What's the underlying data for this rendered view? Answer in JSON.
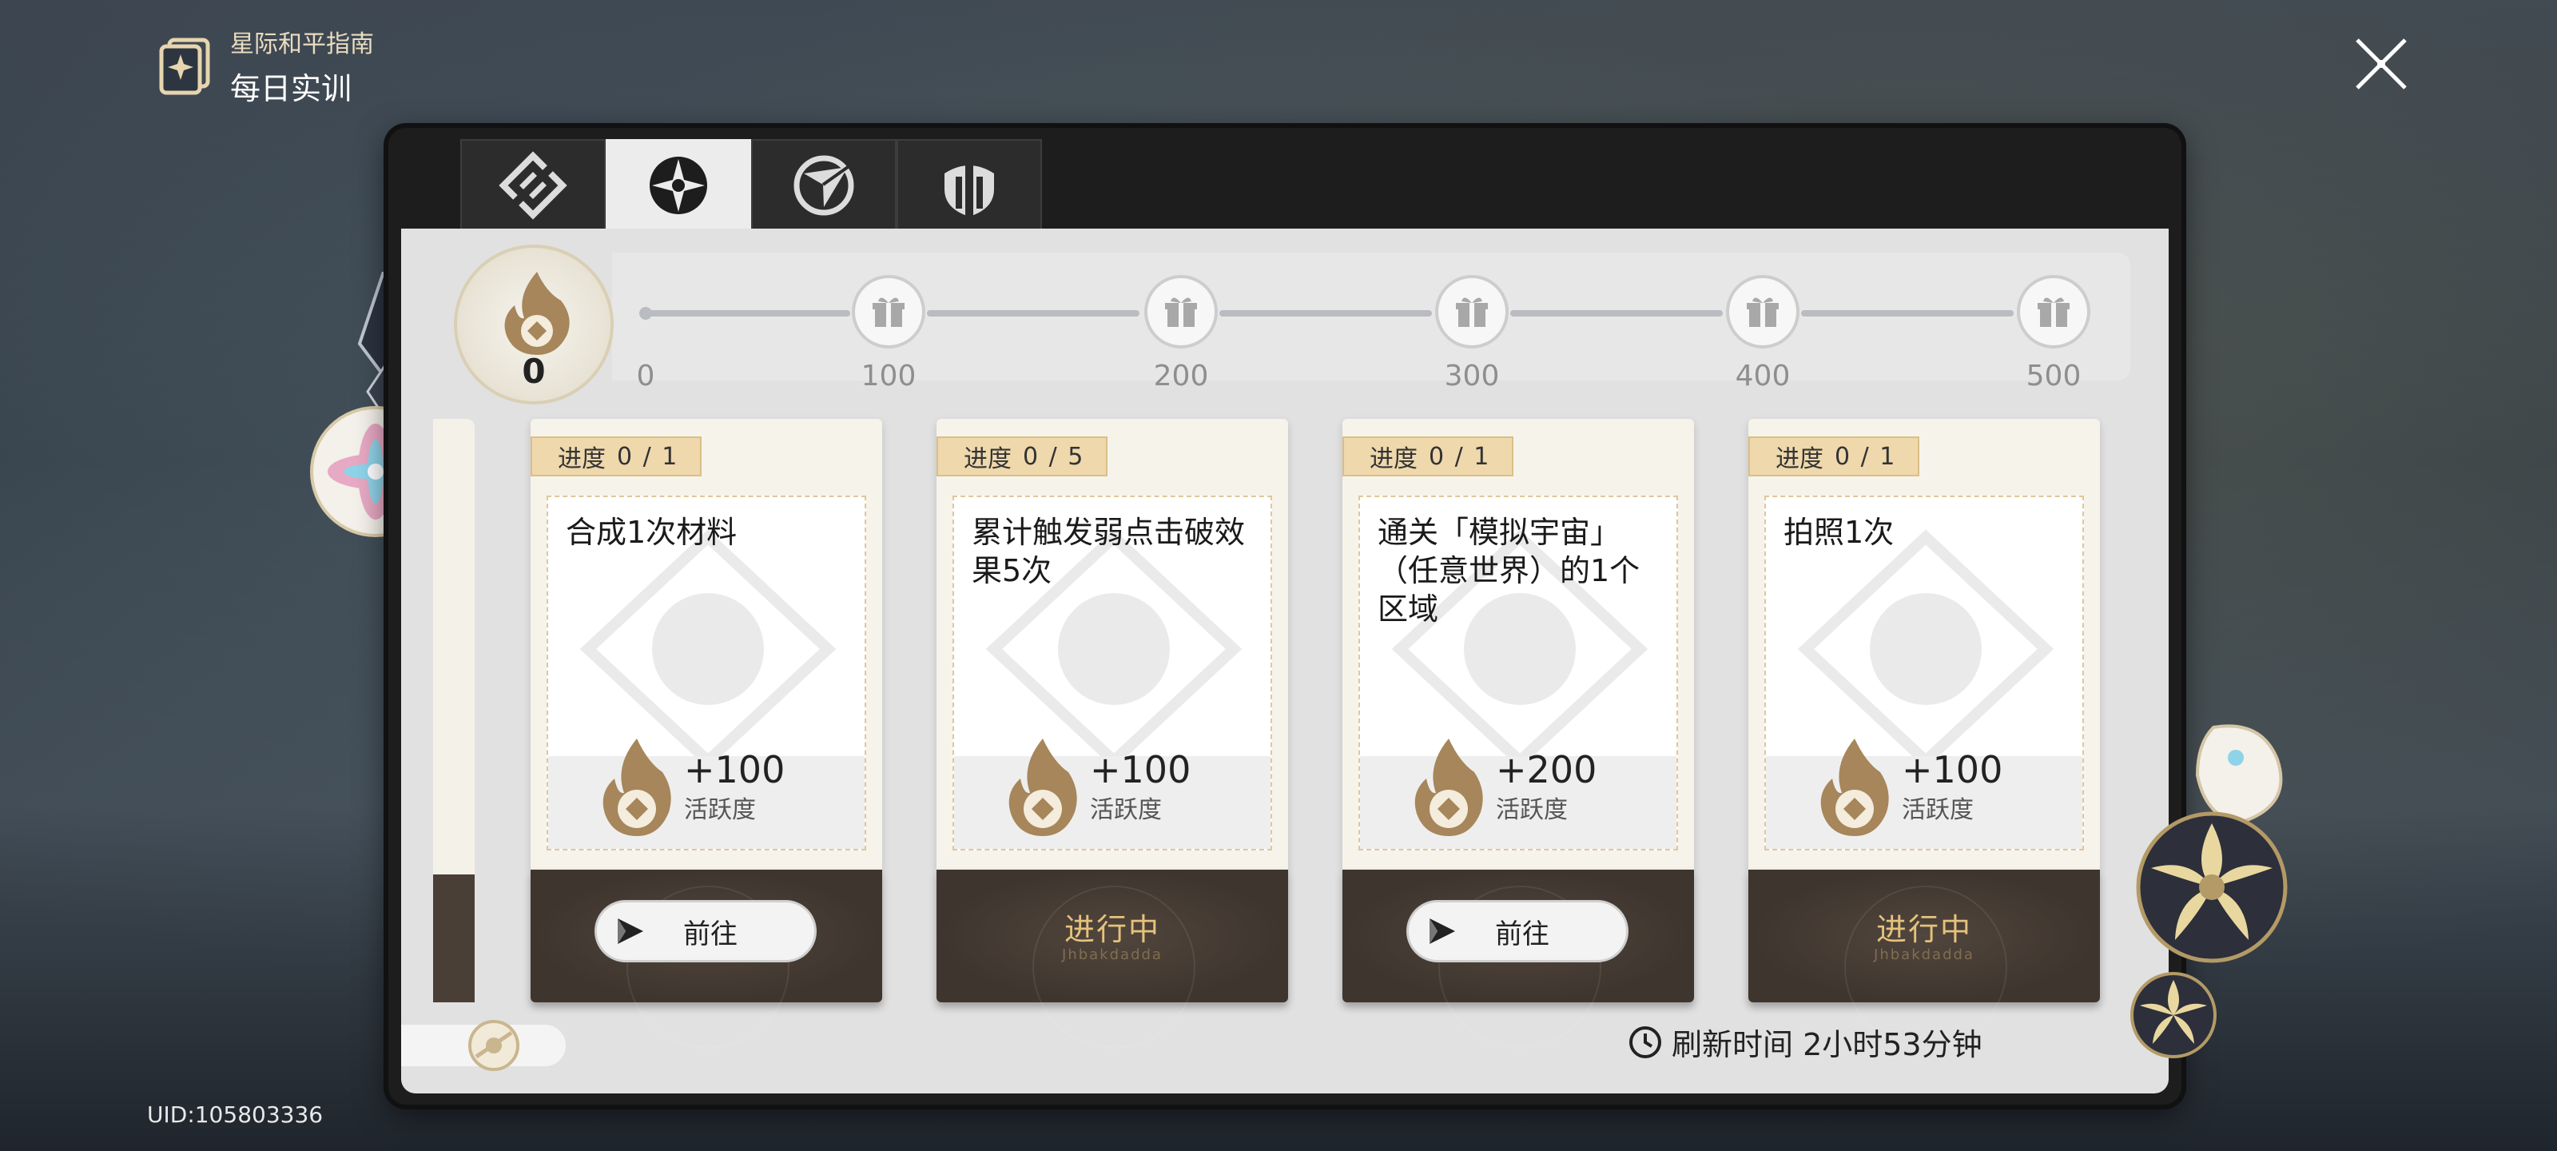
{
  "header": {
    "subtitle": "星际和平指南",
    "title": "每日实训",
    "icon": "guide-book-icon"
  },
  "close_button": {
    "icon": "close-icon"
  },
  "uid": "UID:105803336",
  "tabs": [
    {
      "icon": "tab-emblem-1-icon",
      "active": false
    },
    {
      "icon": "tab-emblem-2-icon",
      "active": true
    },
    {
      "icon": "tab-emblem-3-icon",
      "active": false
    },
    {
      "icon": "tab-emblem-4-icon",
      "active": false
    }
  ],
  "activity": {
    "value": "0",
    "icon": "activity-flame-icon"
  },
  "milestones": {
    "start": "0",
    "items": [
      {
        "label": "100",
        "icon": "gift-icon"
      },
      {
        "label": "200",
        "icon": "gift-icon"
      },
      {
        "label": "300",
        "icon": "gift-icon"
      },
      {
        "label": "400",
        "icon": "gift-icon"
      },
      {
        "label": "500",
        "icon": "gift-icon"
      }
    ]
  },
  "cards": [
    {
      "progress_label": "进度",
      "progress": "0 / 1",
      "title": "合成1次材料",
      "reward": "+100",
      "reward_label": "活跃度",
      "action_type": "go",
      "action_label": "前往"
    },
    {
      "progress_label": "进度",
      "progress": "0 / 5",
      "title": "累计触发弱点击破效果5次",
      "reward": "+100",
      "reward_label": "活跃度",
      "action_type": "status",
      "action_label": "进行中",
      "action_sublabel": "Jhbakdadda"
    },
    {
      "progress_label": "进度",
      "progress": "0 / 1",
      "title": "通关「模拟宇宙」（任意世界）的1个区域",
      "reward": "+200",
      "reward_label": "活跃度",
      "action_type": "go",
      "action_label": "前往"
    },
    {
      "progress_label": "进度",
      "progress": "0 / 1",
      "title": "拍照1次",
      "reward": "+100",
      "reward_label": "活跃度",
      "action_type": "status",
      "action_label": "进行中",
      "action_sublabel": "Jhbakdadda"
    }
  ],
  "refresh": {
    "text": "刷新时间 2小时53分钟",
    "icon": "clock-icon"
  },
  "colors": {
    "accent_gold": "#e5c27c",
    "card_dark": "#4a3f37",
    "chip": "#eed8ac"
  }
}
